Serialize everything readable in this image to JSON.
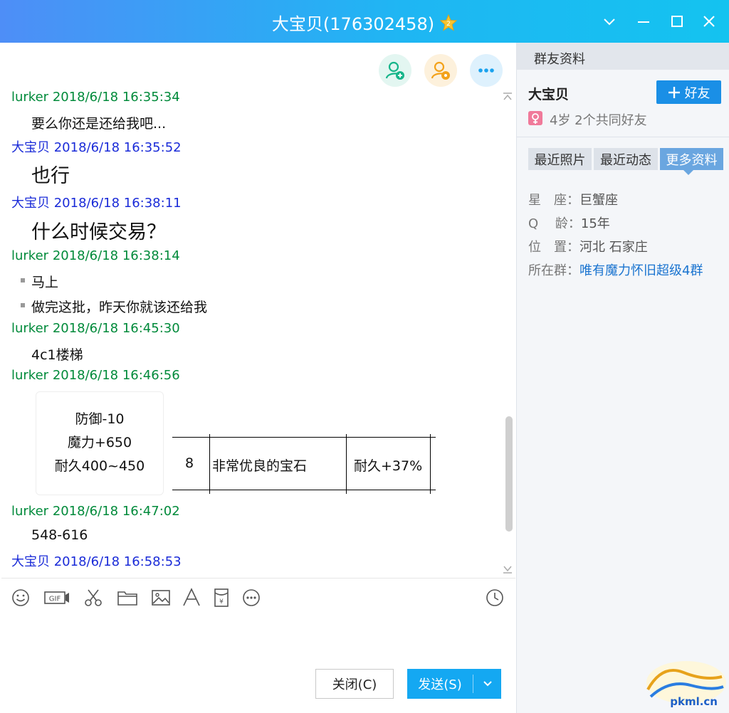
{
  "window": {
    "title": "大宝贝(176302458)",
    "accent": "#1fb6f3"
  },
  "chat": {
    "messages": [
      {
        "sender": "lurker",
        "time": "2018/6/18 16:35:34",
        "lines": [
          "要么你还是还给我吧..."
        ]
      },
      {
        "sender": "大宝贝",
        "time": "2018/6/18 16:35:52",
        "lines": [
          "也行"
        ]
      },
      {
        "sender": "大宝贝",
        "time": "2018/6/18 16:38:11",
        "lines": [
          "什么时候交易？"
        ]
      },
      {
        "sender": "lurker",
        "time": "2018/6/18 16:38:14",
        "lines": [
          "马上",
          "做完这批，昨天你就该还给我"
        ]
      },
      {
        "sender": "lurker",
        "time": "2018/6/18 16:45:30",
        "lines": [
          "4c1楼梯"
        ]
      },
      {
        "sender": "lurker",
        "time": "2018/6/18 16:46:56",
        "lines": []
      },
      {
        "sender": "lurker",
        "time": "2018/6/18 16:47:02",
        "lines": [
          "548-616"
        ]
      },
      {
        "sender": "大宝贝",
        "time": "2018/6/18 16:58:53",
        "lines": []
      }
    ],
    "item_card": {
      "lines": [
        "防御-10",
        "魔力+650",
        "耐久400~450"
      ]
    },
    "item_table": {
      "cells": [
        "8",
        "非常优良的宝石",
        "耐久+37%"
      ]
    }
  },
  "footer": {
    "close_label": "关闭(C)",
    "send_label": "发送(S)"
  },
  "panel": {
    "header": "群友资料",
    "name": "大宝贝",
    "add_friend": "好友",
    "sub": "4岁  2个共同好友",
    "tabs": [
      "最近照片",
      "最近动态",
      "更多资料"
    ],
    "info": [
      {
        "label": "星　座：",
        "value": "巨蟹座"
      },
      {
        "label": "Q　 龄：",
        "value": "15年"
      },
      {
        "label": "位　置：",
        "value": "河北 石家庄"
      },
      {
        "label": "所在群：",
        "value": "唯有魔力怀旧超级4群"
      }
    ]
  },
  "watermark": {
    "text": "pkml.cn"
  }
}
